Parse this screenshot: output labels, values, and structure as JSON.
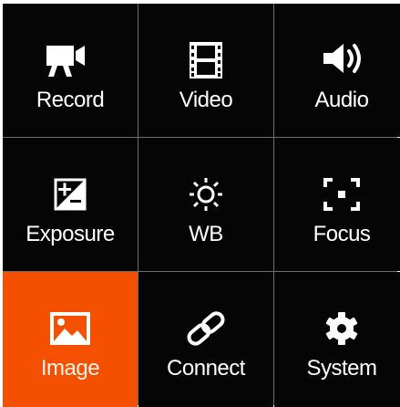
{
  "menu": {
    "items": [
      {
        "label": "Record",
        "icon": "video-camera-icon"
      },
      {
        "label": "Video",
        "icon": "film-strip-icon"
      },
      {
        "label": "Audio",
        "icon": "speaker-icon"
      },
      {
        "label": "Exposure",
        "icon": "exposure-compensation-icon"
      },
      {
        "label": "WB",
        "icon": "sun-icon"
      },
      {
        "label": "Focus",
        "icon": "focus-frame-icon"
      },
      {
        "label": "Image",
        "icon": "image-icon",
        "selected": true
      },
      {
        "label": "Connect",
        "icon": "link-icon"
      },
      {
        "label": "System",
        "icon": "gear-icon"
      }
    ],
    "selected_index": 6
  },
  "colors": {
    "tile_background": "#050505",
    "selected_background": "#f45000",
    "grid_lines": "#6d6d6d",
    "text": "#ffffff"
  }
}
